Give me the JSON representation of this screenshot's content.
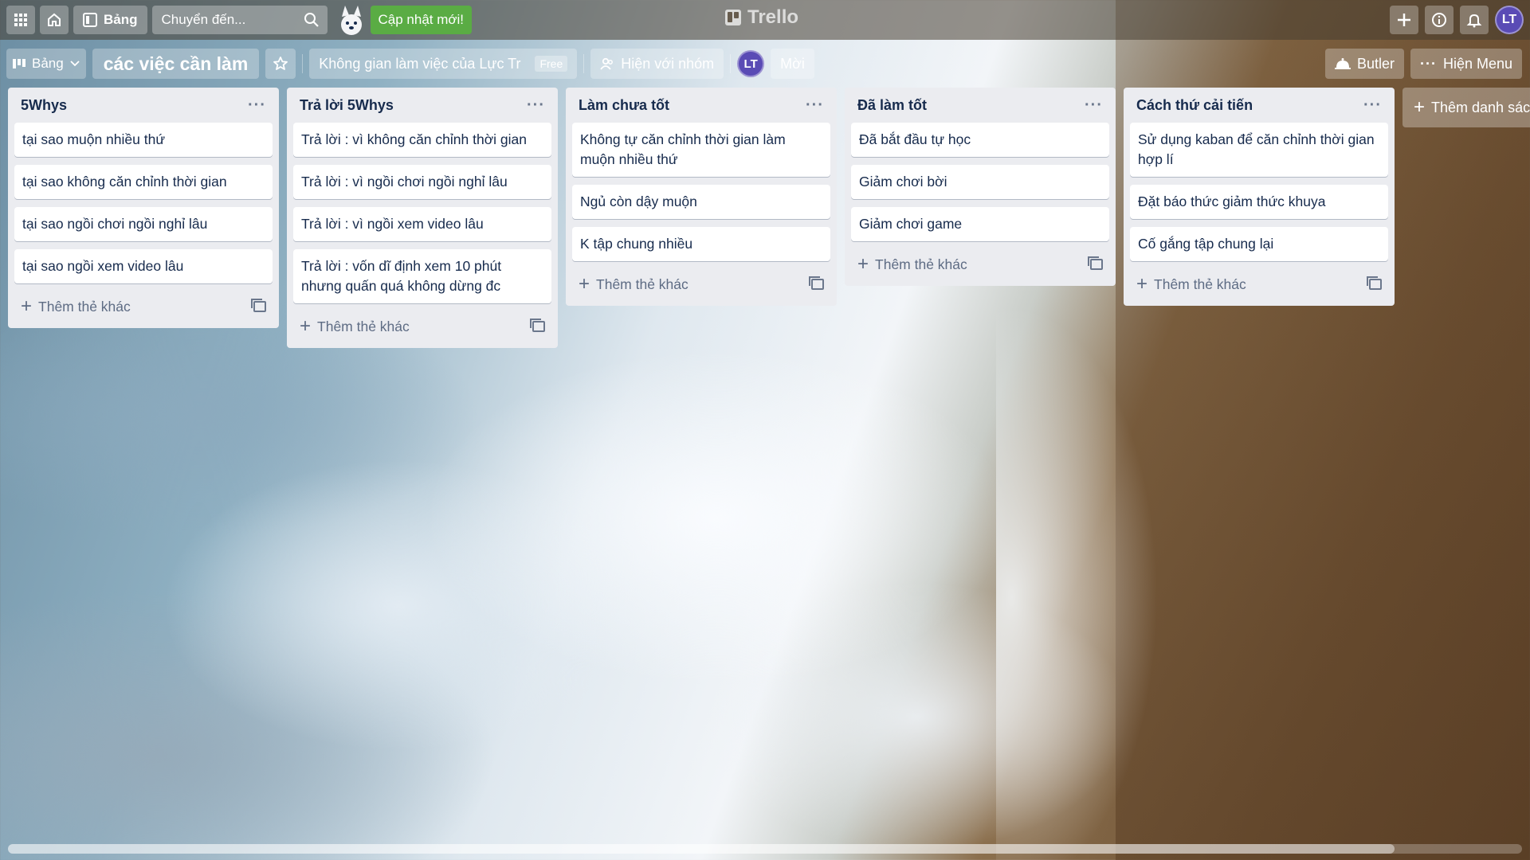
{
  "topbar": {
    "boards_label": "Bảng",
    "search_placeholder": "Chuyển đến...",
    "update_label": "Cập nhật mới!",
    "logo_text": "Trello",
    "avatar_initials": "LT"
  },
  "boardbar": {
    "view_switch_label": "Bảng",
    "title": "các việc cần làm",
    "workspace_label": "Không gian làm việc của Lực Tr",
    "workspace_badge": "Free",
    "visibility_label": "Hiện với nhóm",
    "member_initials": "LT",
    "invite_label": "Mời",
    "butler_label": "Butler",
    "menu_label": "Hiện Menu"
  },
  "add_card_label": "Thêm thẻ khác",
  "add_list_label": "Thêm danh sách khác",
  "lists": [
    {
      "title": "5Whys",
      "cards": [
        "tại sao muộn nhiều thứ",
        "tại sao không căn chỉnh thời gian",
        "tại sao ngồi chơi ngồi nghỉ lâu",
        "tại sao ngồi xem video lâu"
      ]
    },
    {
      "title": "Trả lời 5Whys",
      "cards": [
        "Trả lời : vì không căn chỉnh thời gian",
        "Trả lời : vì ngồi chơi ngồi nghỉ lâu",
        "Trả lời : vì ngồi xem video lâu",
        "Trả lời : vốn dĩ định xem 10 phút nhưng quấn quá không dừng đc"
      ]
    },
    {
      "title": "Làm chưa tốt",
      "cards": [
        "Không tự căn chỉnh thời gian làm muộn nhiều thứ",
        "Ngủ còn dậy muộn",
        "K tập chung nhiều"
      ]
    },
    {
      "title": "Đã làm tốt",
      "cards": [
        "Đã bắt đầu tự học",
        "Giảm chơi bời",
        "Giảm chơi game"
      ]
    },
    {
      "title": "Cách thứ cải tiến",
      "cards": [
        "Sử dụng kaban để căn chỉnh thời gian hợp lí",
        "Đặt báo thức giảm thức khuya",
        "Cố gắng tập chung lại"
      ]
    }
  ],
  "icons": {
    "apps": "apps-grid-icon",
    "home": "home-icon",
    "board": "board-icon",
    "search": "search-icon",
    "plus": "plus-icon",
    "info": "info-icon",
    "bell": "bell-icon",
    "star": "star-icon",
    "template": "card-template-icon"
  },
  "colors": {
    "update_green": "#5aac44",
    "avatar_purple": "#5a4bb5",
    "list_bg": "#ebecf0"
  }
}
